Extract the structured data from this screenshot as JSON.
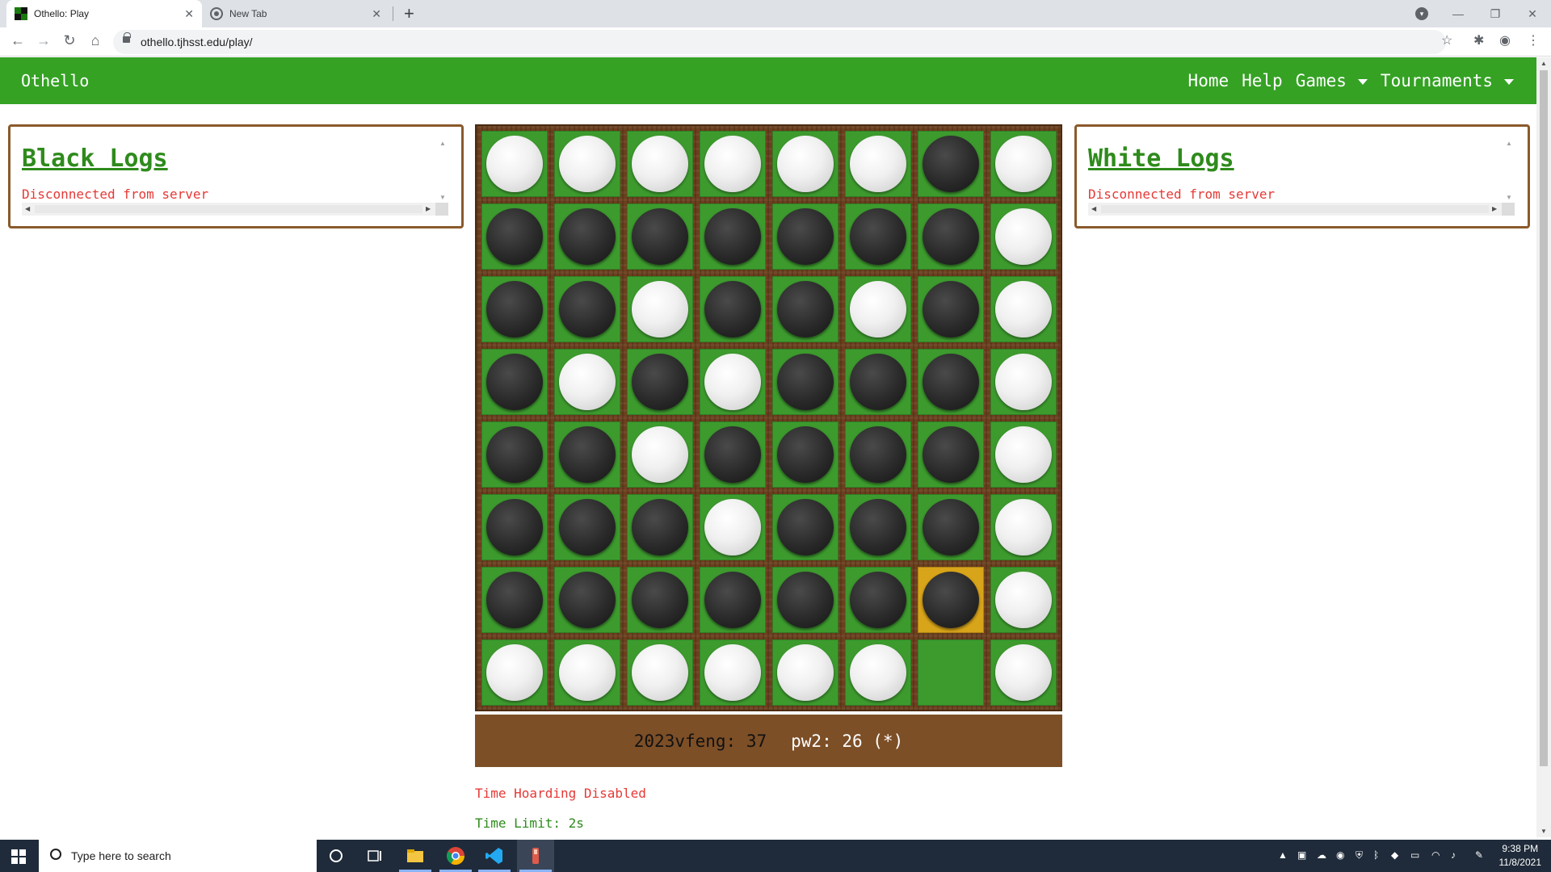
{
  "browser": {
    "tabs": [
      {
        "title": "Othello: Play",
        "active": true
      },
      {
        "title": "New Tab",
        "active": false
      }
    ],
    "url": "othello.tjhsst.edu/play/"
  },
  "navbar": {
    "brand": "Othello",
    "links": [
      {
        "label": "Home",
        "dropdown": false
      },
      {
        "label": "Help",
        "dropdown": false
      },
      {
        "label": "Games",
        "dropdown": true
      },
      {
        "label": "Tournaments",
        "dropdown": true
      }
    ]
  },
  "black_log": {
    "title": "Black Logs",
    "status": "Disconnected from server"
  },
  "white_log": {
    "title": "White Logs",
    "status": "Disconnected from server"
  },
  "board": {
    "rows": [
      "WWWWWWBW",
      "BBBBBBBW",
      "BBWBBWBW",
      "BWBWBBBW",
      "BBWBBBBW",
      "BBBWBBBW",
      "BBBBBBBW",
      "WWWWWW.W"
    ],
    "last_move": {
      "row": 6,
      "col": 6
    },
    "colors": {
      "cell": "#3d9b2e",
      "highlight": "#d8a419",
      "frame": "#6b3f1e"
    }
  },
  "score": {
    "black": "2023vfeng: 37",
    "white": "pw2: 26 (*)"
  },
  "info": {
    "hoarding": "Time Hoarding Disabled",
    "time_limit": "Time Limit: 2s"
  },
  "taskbar": {
    "search_placeholder": "Type here to search",
    "time": "9:38 PM",
    "date": "11/8/2021"
  }
}
